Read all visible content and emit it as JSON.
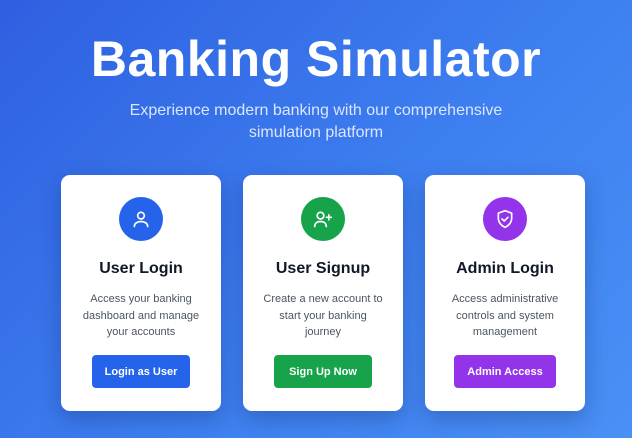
{
  "hero": {
    "title": "Banking Simulator",
    "subtitle": "Experience modern banking with our comprehensive simulation platform"
  },
  "cards": [
    {
      "icon": "user-icon",
      "title": "User Login",
      "description": "Access your banking dashboard and manage your accounts",
      "button_label": "Login as User",
      "accent": "#2563eb"
    },
    {
      "icon": "user-plus-icon",
      "title": "User Signup",
      "description": "Create a new account to start your banking journey",
      "button_label": "Sign Up Now",
      "accent": "#16a34a"
    },
    {
      "icon": "shield-check-icon",
      "title": "Admin Login",
      "description": "Access administrative controls and system management",
      "button_label": "Admin Access",
      "accent": "#9333ea"
    }
  ],
  "colors": {
    "background_start": "#2f5fe0",
    "background_end": "#4a90f5"
  }
}
